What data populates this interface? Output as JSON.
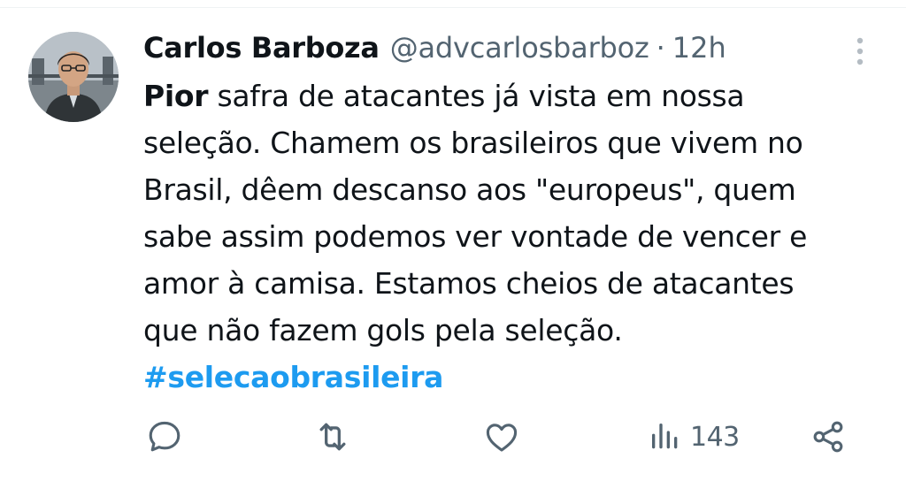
{
  "tweet": {
    "author_name": "Carlos Barboza",
    "handle": "@advcarlosbarboz",
    "separator": "·",
    "time": "12h",
    "text_bold_start": "Pior",
    "text_line1_rest": " safra de atacantes já vista em nossa",
    "text_line2": "seleção. Chamem os brasileiros que vivem no",
    "text_line3": "Brasil, dêem descanso aos \"europeus\", quem",
    "text_line4": "sabe assim podemos ver vontade de vencer e",
    "text_line5": "amor à camisa. Estamos cheios de atacantes",
    "text_line6": "que não fazem gols pela seleção.",
    "hashtag": "#selecaobrasileira"
  },
  "actions": {
    "reply_icon": "reply-icon",
    "retweet_icon": "retweet-icon",
    "like_icon": "heart-icon",
    "views_icon": "views-icon",
    "views_count": "143",
    "share_icon": "share-icon"
  },
  "colors": {
    "link": "#1d9bf0",
    "secondary_text": "#536471",
    "primary_text": "#0f1419"
  }
}
